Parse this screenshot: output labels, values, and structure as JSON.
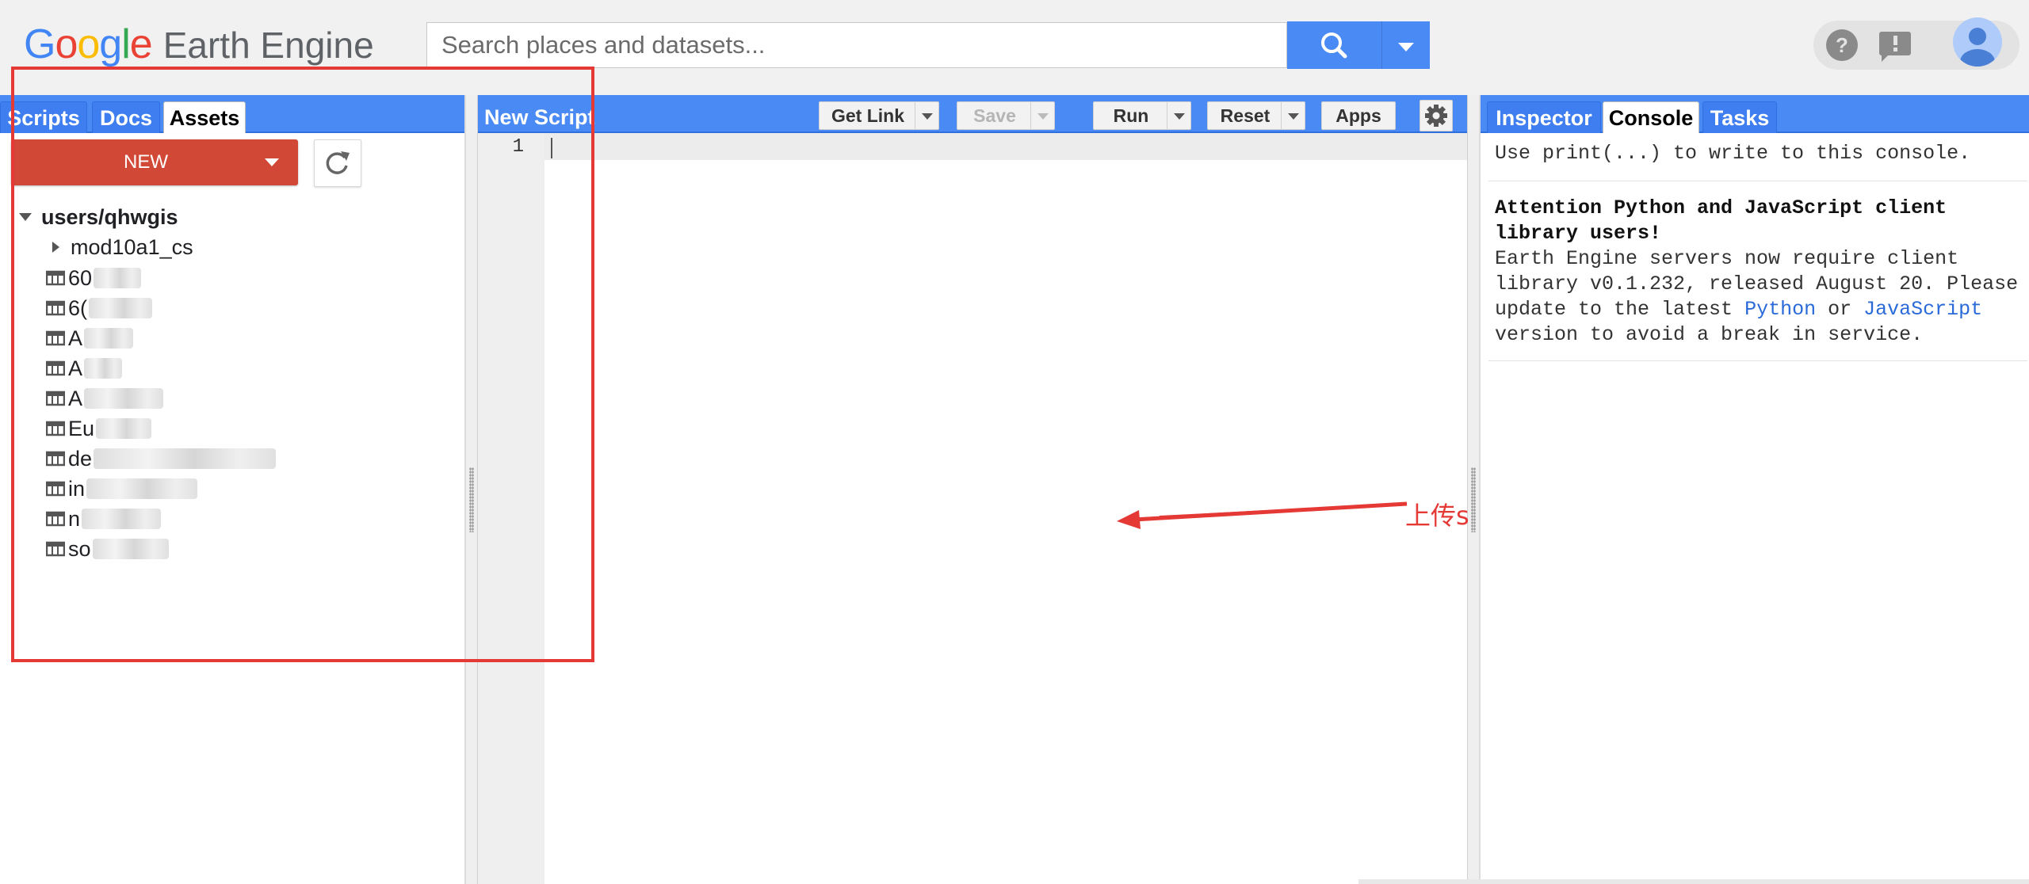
{
  "header": {
    "logo_google": "Google",
    "logo_product": "Earth Engine",
    "search_placeholder": "Search places and datasets...",
    "icons": [
      "search-icon",
      "chevron-down-icon",
      "help-icon",
      "feedback-icon",
      "account-icon"
    ]
  },
  "left_panel": {
    "tabs": [
      {
        "label": "Scripts",
        "active": false
      },
      {
        "label": "Docs",
        "active": false
      },
      {
        "label": "Assets",
        "active": true
      }
    ],
    "new_button": "NEW",
    "tree": {
      "root": "users/qhwgis",
      "folder": "mod10a1_cs",
      "assets": [
        {
          "label": "60"
        },
        {
          "label": "6("
        },
        {
          "label": "A"
        },
        {
          "label": "A"
        },
        {
          "label": "A"
        },
        {
          "label": "Eu"
        },
        {
          "label": "de"
        },
        {
          "label": "in"
        },
        {
          "label": "n"
        },
        {
          "label": "so"
        }
      ]
    }
  },
  "editor": {
    "title": "New Script",
    "toolbar": {
      "get_link": "Get Link",
      "save": "Save",
      "run": "Run",
      "reset": "Reset",
      "apps": "Apps"
    },
    "line_number": "1",
    "annotation_text": "上传shape文件"
  },
  "right_panel": {
    "tabs": [
      {
        "label": "Inspector",
        "active": false
      },
      {
        "label": "Console",
        "active": true
      },
      {
        "label": "Tasks",
        "active": false
      }
    ],
    "console": {
      "hint": "Use print(...) to write to this console.",
      "attention_line1": "Attention Python and JavaScript client",
      "attention_line2": "library users!",
      "msg_line1": "Earth Engine servers now require client",
      "msg_line2": "library v0.1.232, released August 20. Please",
      "msg_line3_before": "update to the latest ",
      "msg_link_python": "Python",
      "msg_line3_mid": " or ",
      "msg_link_js": "JavaScript",
      "msg_line4": "version to avoid a break in service."
    }
  },
  "colors": {
    "accent_blue": "#4a8af4",
    "new_button_red": "#d14836",
    "annotation_red": "#e53935"
  }
}
